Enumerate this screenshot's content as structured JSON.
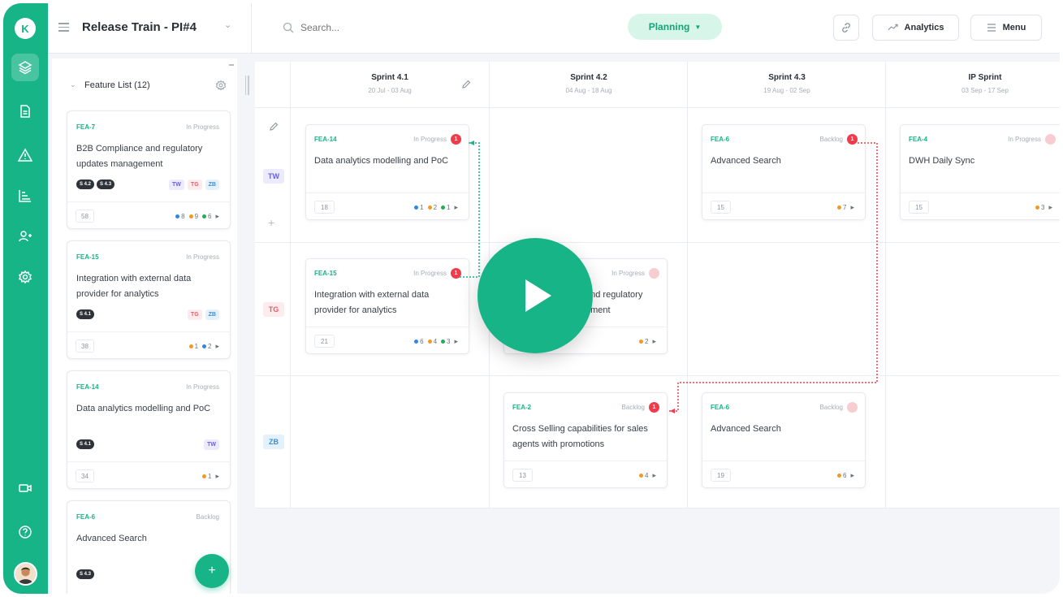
{
  "app": {
    "logo_letter": "K",
    "project_title": "Release Train - PI#4"
  },
  "topbar": {
    "search_placeholder": "Search...",
    "mode": "Planning",
    "analytics_label": "Analytics",
    "menu_label": "Menu"
  },
  "rail": {
    "icons": [
      "layers-icon",
      "document-icon",
      "warning-icon",
      "chart-icon",
      "users-icon",
      "settings-icon",
      "video-icon",
      "help-icon"
    ],
    "active": "layers-icon"
  },
  "feature_list": {
    "title": "Feature List (12)",
    "cards": [
      {
        "id": "FEA-7",
        "status": "In Progress",
        "title": "B2B Compliance and regulatory updates management",
        "chips": [
          "S 4.2",
          "S 4.3"
        ],
        "tags": [
          "TW",
          "TG",
          "ZB"
        ],
        "points": "58",
        "stats": [
          {
            "color": "blue",
            "value": "8"
          },
          {
            "color": "orange",
            "value": "9"
          },
          {
            "color": "green",
            "value": "6"
          }
        ]
      },
      {
        "id": "FEA-15",
        "status": "In Progress",
        "title": "Integration with external data provider for analytics",
        "chips": [
          "S 4.1"
        ],
        "tags": [
          "TG",
          "ZB"
        ],
        "points": "38",
        "stats": [
          {
            "color": "orange",
            "value": "1"
          },
          {
            "color": "blue",
            "value": "2"
          }
        ]
      },
      {
        "id": "FEA-14",
        "status": "In Progress",
        "title": "Data analytics modelling and PoC",
        "chips": [
          "S 4.1"
        ],
        "tags": [
          "TW"
        ],
        "points": "34",
        "stats": [
          {
            "color": "orange",
            "value": "1"
          }
        ]
      },
      {
        "id": "FEA-6",
        "status": "Backlog",
        "title": "Advanced Search",
        "chips": [
          "S 4.3"
        ],
        "tags": []
      }
    ],
    "add_label": "+"
  },
  "board": {
    "sprints": [
      {
        "name": "Sprint 4.1",
        "dates": "20 Jul - 03 Aug"
      },
      {
        "name": "Sprint 4.2",
        "dates": "04 Aug - 18 Aug"
      },
      {
        "name": "Sprint 4.3",
        "dates": "19 Aug - 02 Sep"
      },
      {
        "name": "IP Sprint",
        "dates": "03 Sep - 17 Sep"
      }
    ],
    "teams": [
      "TW",
      "TG",
      "ZB"
    ],
    "add_team": "+",
    "cards": [
      {
        "id": "FEA-14",
        "status": "In Progress",
        "badge": "1",
        "title": "Data analytics modelling and PoC",
        "points": "18",
        "stats": [
          {
            "color": "blue",
            "value": "1"
          },
          {
            "color": "orange",
            "value": "2"
          },
          {
            "color": "green",
            "value": "1"
          }
        ]
      },
      {
        "id": "FEA-6",
        "status": "Backlog",
        "badge": "1",
        "title": "Advanced Search",
        "points": "15",
        "stats": [
          {
            "color": "orange",
            "value": "7"
          }
        ]
      },
      {
        "id": "FEA-4",
        "status": "In Progress",
        "badge": "",
        "title": "DWH Daily Sync",
        "points": "15",
        "stats": [
          {
            "color": "orange",
            "value": "3"
          }
        ]
      },
      {
        "id": "FEA-15",
        "status": "In Progress",
        "badge": "1",
        "title": "Integration with external data provider for analytics",
        "points": "21",
        "stats": [
          {
            "color": "blue",
            "value": "6"
          },
          {
            "color": "orange",
            "value": "4"
          },
          {
            "color": "green",
            "value": "3"
          }
        ]
      },
      {
        "id": "",
        "status": "In Progress",
        "badge": "",
        "title": "and regulatory\nement",
        "points": "",
        "stats": [
          {
            "color": "orange",
            "value": "2"
          }
        ]
      },
      {
        "id": "FEA-2",
        "status": "Backlog",
        "badge": "1",
        "title": "Cross Selling capabilities for sales agents with promotions",
        "points": "13",
        "stats": [
          {
            "color": "orange",
            "value": "4"
          }
        ]
      },
      {
        "id": "FEA-6",
        "status": "Backlog",
        "badge": "",
        "title": "Advanced Search",
        "points": "19",
        "stats": [
          {
            "color": "orange",
            "value": "6"
          }
        ]
      }
    ]
  },
  "colors": {
    "brand": "#17b487",
    "danger": "#ef3b4a",
    "text": "#2a2f36"
  }
}
